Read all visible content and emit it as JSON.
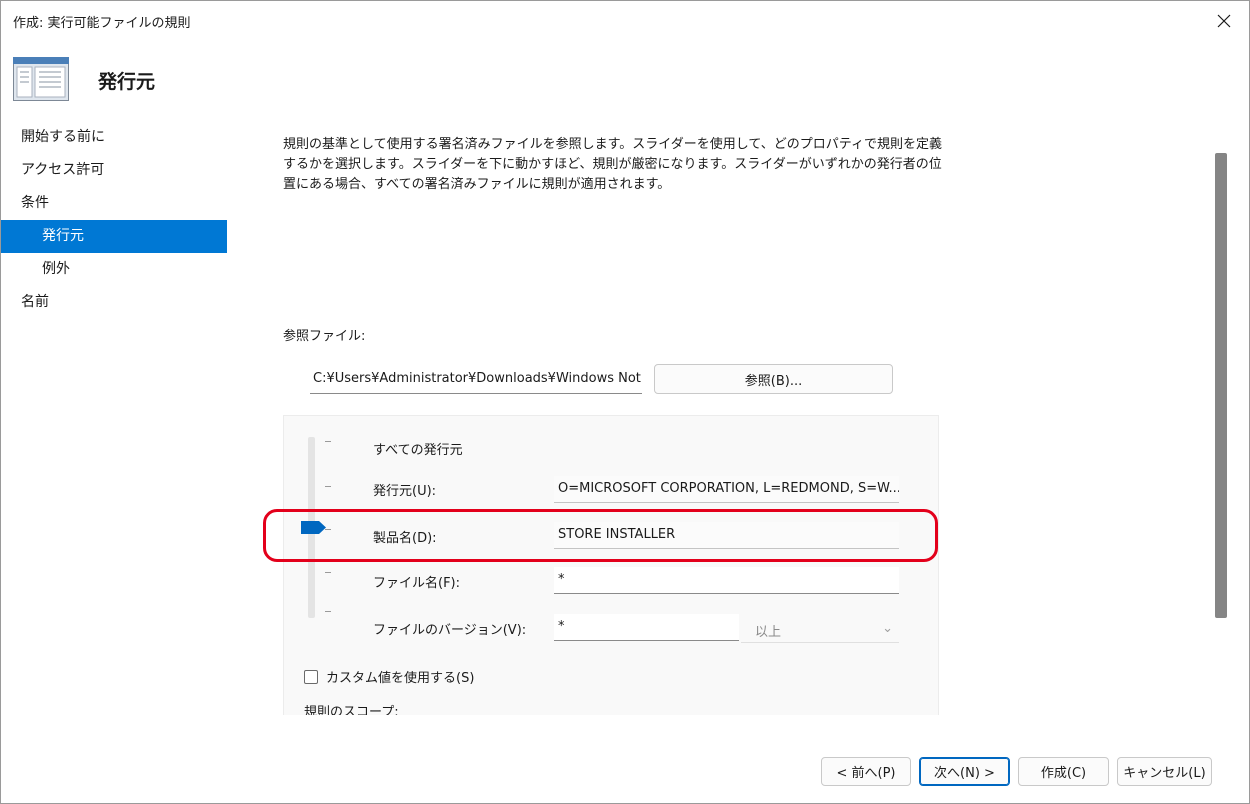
{
  "window": {
    "title": "作成: 実行可能ファイルの規則",
    "header_title": "発行元"
  },
  "nav": {
    "items": [
      {
        "label": "開始する前に"
      },
      {
        "label": "アクセス許可"
      },
      {
        "label": "条件"
      },
      {
        "label": "発行元"
      },
      {
        "label": "例外"
      },
      {
        "label": "名前"
      }
    ]
  },
  "main": {
    "description": "規則の基準として使用する署名済みファイルを参照します。スライダーを使用して、どのプロパティで規則を定義するかを選択します。スライダーを下に動かすほど、規則が厳密になります。スライダーがいずれかの発行者の位置にある場合、すべての署名済みファイルに規則が適用されます。",
    "reference_label": "参照ファイル:",
    "reference_path": "C:¥Users¥Administrator¥Downloads¥Windows Not",
    "browse_label": "参照(B)...",
    "all_publishers_label": "すべての発行元",
    "publisher_label": "発行元(U):",
    "publisher_value": "O=MICROSOFT CORPORATION, L=REDMOND, S=W...",
    "product_label": "製品名(D):",
    "product_value": "STORE INSTALLER",
    "filename_label": "ファイル名(F):",
    "filename_value": "*",
    "version_label": "ファイルのバージョン(V):",
    "version_value": "*",
    "version_operator": "以上",
    "custom_values_label": "カスタム値を使用する(S)",
    "scope_label": "規則のスコープ:"
  },
  "footer": {
    "back_label": "< 前へ(P)",
    "next_label": "次へ(N) >",
    "create_label": "作成(C)",
    "cancel_label": "キャンセル(L)"
  },
  "slider": {
    "positions": [
      "すべての発行元",
      "発行元",
      "製品名",
      "ファイル名",
      "ファイルのバージョン"
    ],
    "selected": "製品名"
  },
  "colors": {
    "selection": "#0078d4",
    "highlight": "#e3001b"
  }
}
